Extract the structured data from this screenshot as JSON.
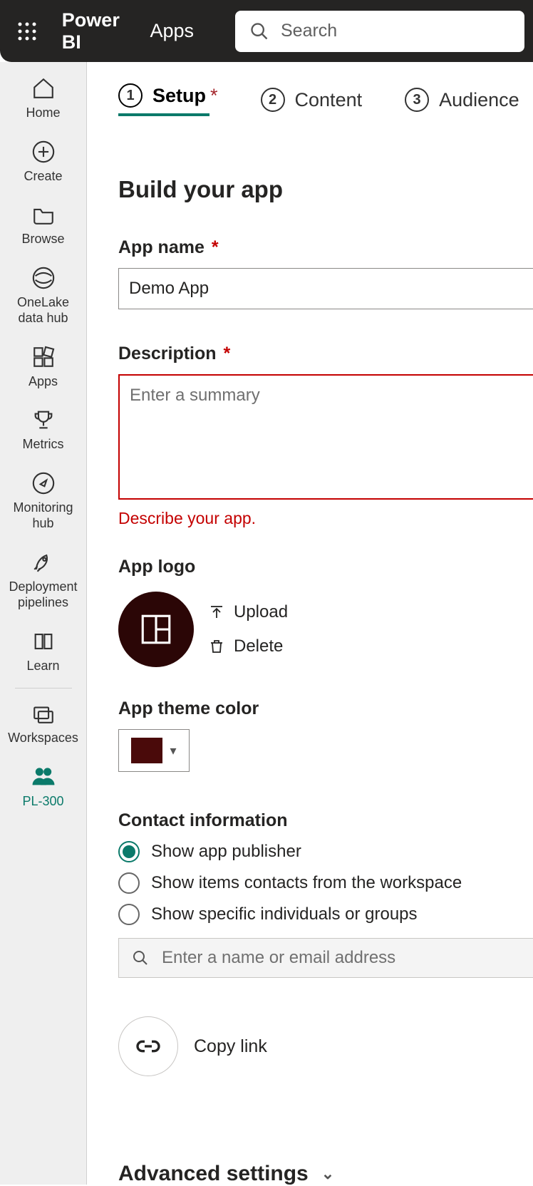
{
  "header": {
    "brand": "Power BI",
    "section": "Apps",
    "search_placeholder": "Search"
  },
  "nav": {
    "items": [
      {
        "label": "Home"
      },
      {
        "label": "Create"
      },
      {
        "label": "Browse"
      },
      {
        "label": "OneLake data hub"
      },
      {
        "label": "Apps"
      },
      {
        "label": "Metrics"
      },
      {
        "label": "Monitoring hub"
      },
      {
        "label": "Deployment pipelines"
      },
      {
        "label": "Learn"
      },
      {
        "label": "Workspaces"
      },
      {
        "label": "PL-300"
      }
    ]
  },
  "steps": {
    "s1": {
      "num": "1",
      "label": "Setup"
    },
    "s2": {
      "num": "2",
      "label": "Content"
    },
    "s3": {
      "num": "3",
      "label": "Audience"
    }
  },
  "form": {
    "title": "Build your app",
    "app_name_label": "App name",
    "app_name_value": "Demo App",
    "description_label": "Description",
    "description_placeholder": "Enter a summary",
    "description_error": "Describe your app.",
    "app_logo_label": "App logo",
    "upload_label": "Upload",
    "delete_label": "Delete",
    "theme_label": "App theme color",
    "theme_color": "#4a0a0a",
    "contact_label": "Contact information",
    "contact_options": [
      "Show app publisher",
      "Show items contacts from the workspace",
      "Show specific individuals or groups"
    ],
    "contact_search_placeholder": "Enter a name or email address",
    "copy_link_label": "Copy link",
    "advanced_label": "Advanced settings"
  }
}
